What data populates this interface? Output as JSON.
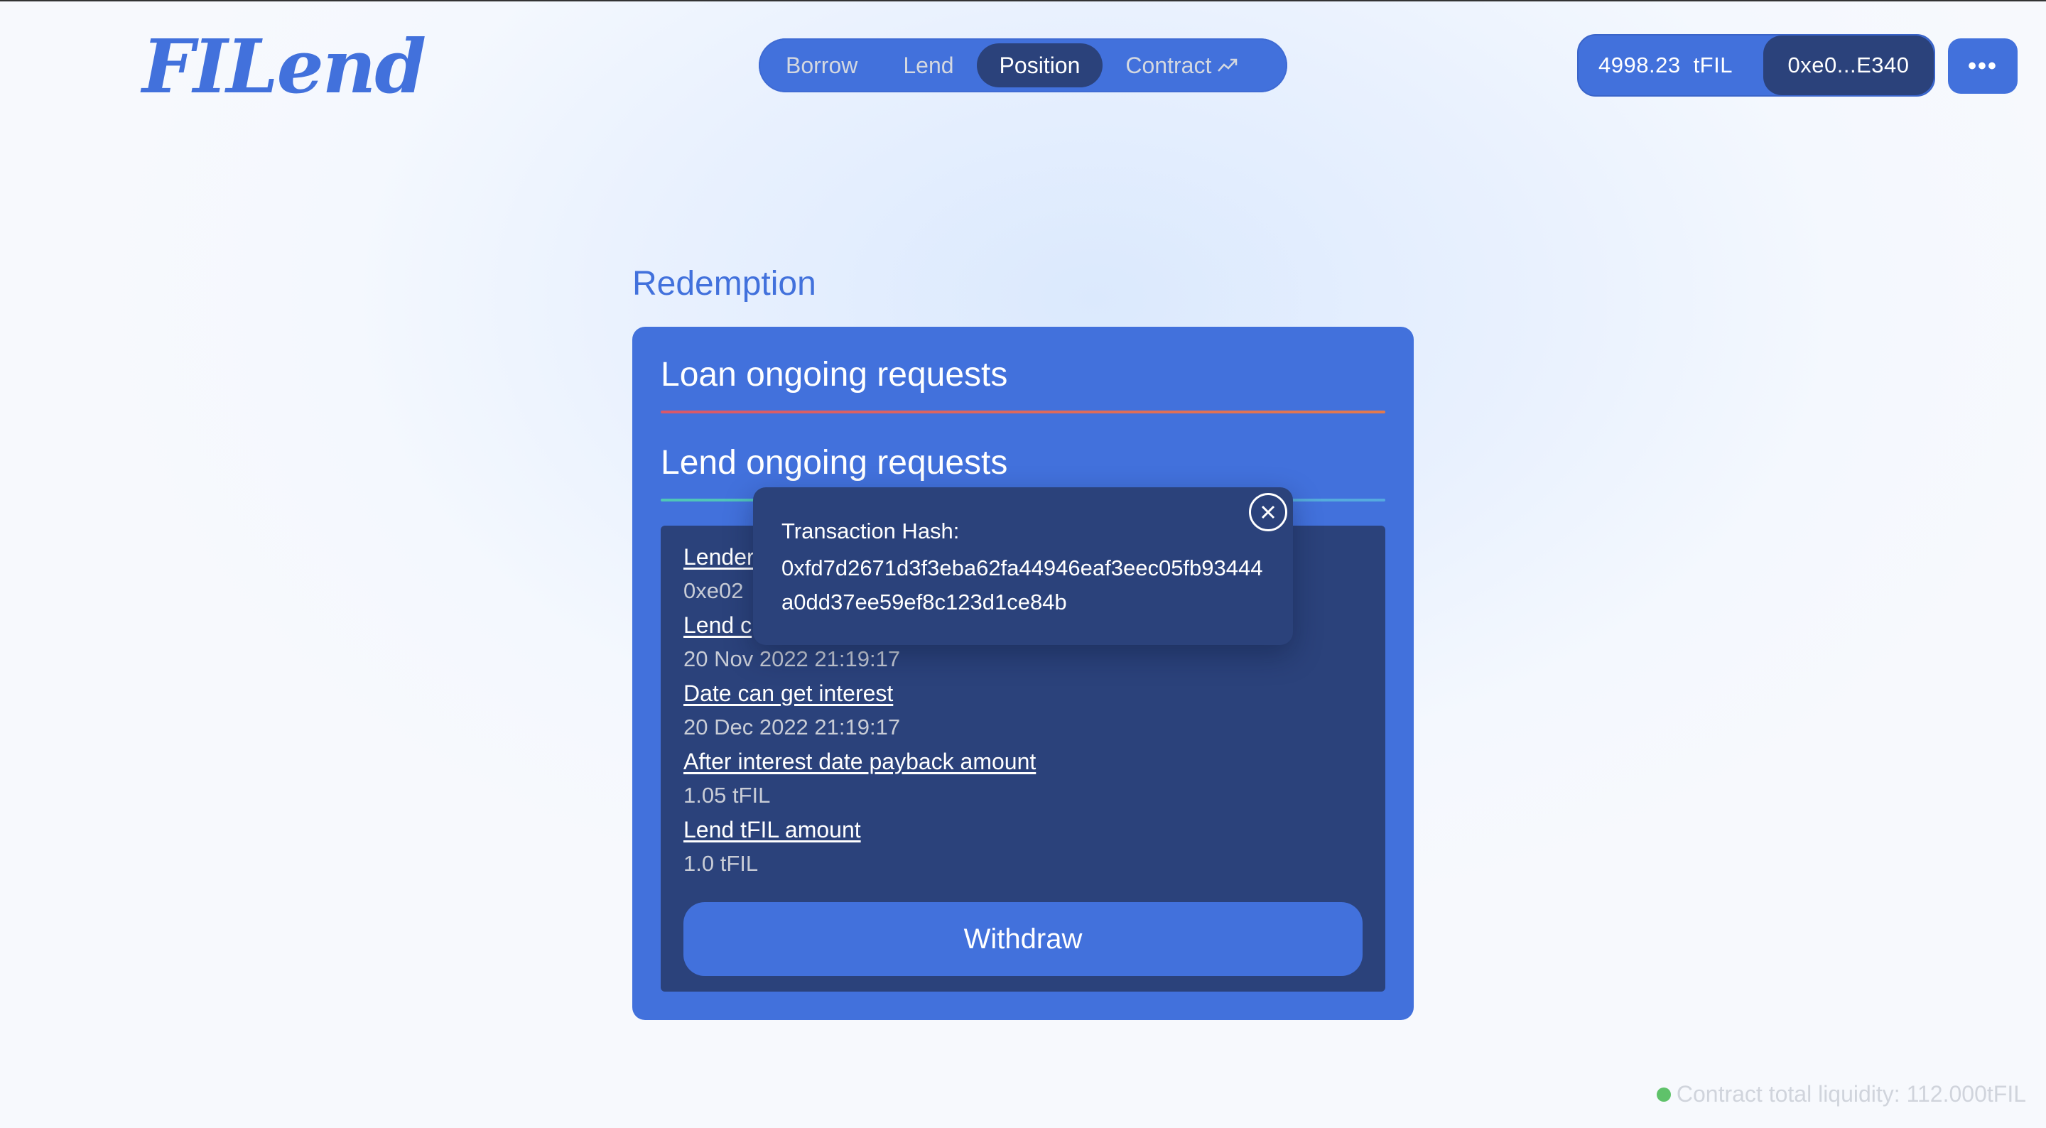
{
  "app": {
    "logo_text": "FILend"
  },
  "nav": {
    "items": [
      {
        "label": "Borrow",
        "active": false
      },
      {
        "label": "Lend",
        "active": false
      },
      {
        "label": "Position",
        "active": true
      },
      {
        "label": "Contract",
        "active": false,
        "icon": "trending-up-arrow-icon"
      }
    ]
  },
  "wallet": {
    "balance": "4998.23",
    "unit": "tFIL",
    "address": "0xe0...E340",
    "more_label": "•••"
  },
  "page": {
    "title": "Redemption"
  },
  "sections": {
    "loan_title": "Loan ongoing requests",
    "lend_title": "Lend ongoing requests"
  },
  "lend_request": {
    "fields": [
      {
        "label": "Lender",
        "value": "0xe02"
      },
      {
        "label": "Lend c",
        "value": "20 Nov 2022 21:19:17"
      },
      {
        "label": "Date can get interest",
        "value": "20 Dec 2022 21:19:17"
      },
      {
        "label": "After interest date payback amount",
        "value": "1.05 tFIL"
      },
      {
        "label": "Lend tFIL amount",
        "value": "1.0 tFIL"
      }
    ],
    "withdraw_label": "Withdraw"
  },
  "toast": {
    "label": "Transaction Hash:",
    "hash": "0xfd7d2671d3f3eba62fa44946eaf3eec05fb93444a0dd37ee59ef8c123d1ce84b"
  },
  "footer": {
    "liquidity_text": "Contract total liquidity: 112.000tFIL",
    "status_color": "#5fc26a"
  },
  "colors": {
    "primary": "#4271dc",
    "dark": "#2b427b"
  }
}
